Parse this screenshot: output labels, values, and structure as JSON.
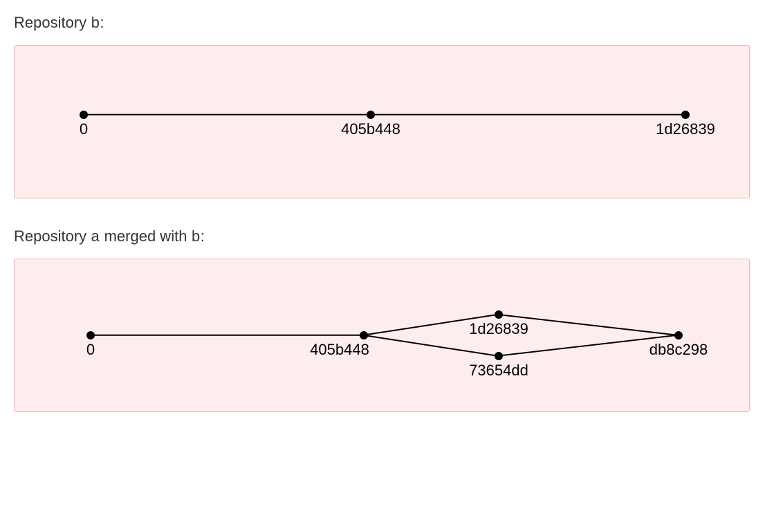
{
  "section1": {
    "prefix": "Repository ",
    "name": "b",
    "suffix": ":",
    "nodes": {
      "n0": "0",
      "n1": "405b448",
      "n2": "1d26839"
    }
  },
  "section2": {
    "prefix": "Repository ",
    "name_a": "a",
    "mid": " merged with ",
    "name_b": "b",
    "suffix": ":",
    "nodes": {
      "m0": "0",
      "m1": "405b448",
      "m2top": "1d26839",
      "m2bot": "73654dd",
      "m3": "db8c298"
    }
  }
}
